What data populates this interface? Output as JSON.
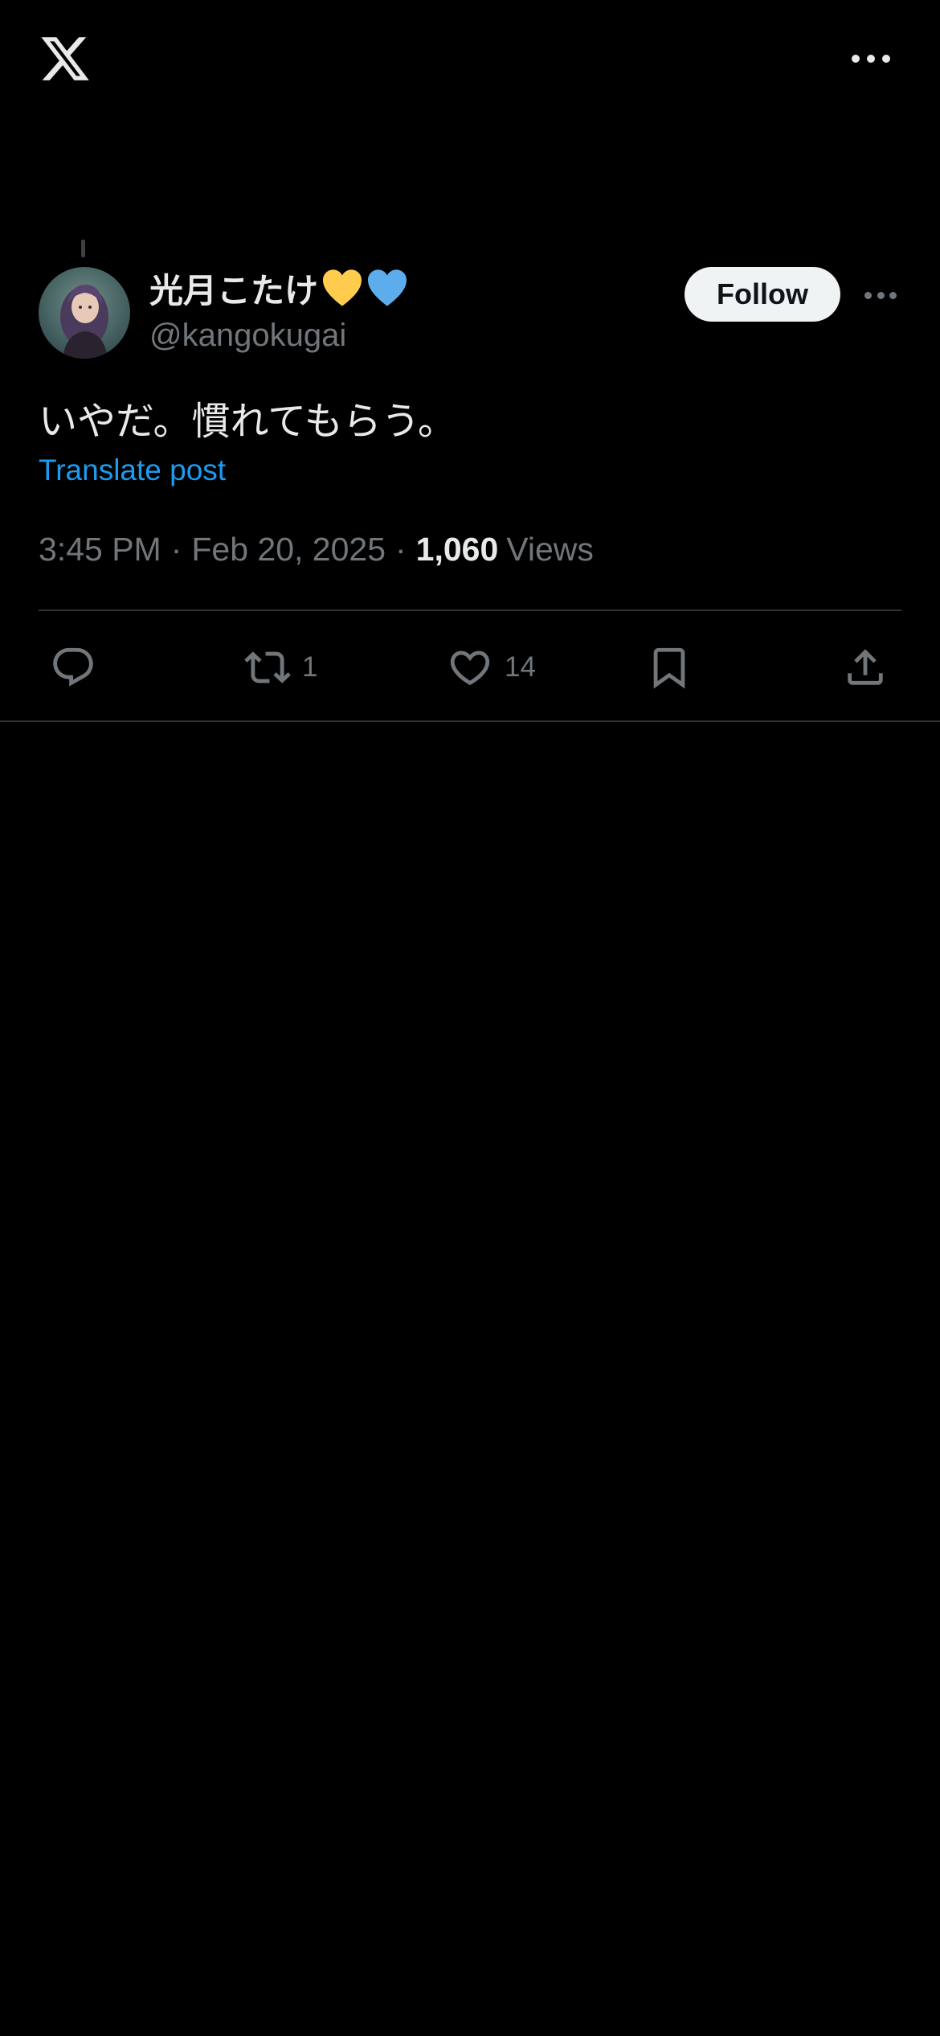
{
  "header": {
    "logo_icon": "x-logo-icon",
    "more_icon": "more-horizontal-icon"
  },
  "post": {
    "author": {
      "display_name": "光月こたけ",
      "name_emojis": [
        "yellow-heart",
        "blue-heart"
      ],
      "handle": "@kangokugai",
      "avatar_icon": "avatar"
    },
    "follow_label": "Follow",
    "text": "いやだ。慣れてもらう。",
    "translate_label": "Translate post",
    "time": "3:45 PM",
    "date": "Feb 20, 2025",
    "separator": "·",
    "views_count": "1,060",
    "views_label": "Views",
    "actions": {
      "reply": {
        "icon": "reply-icon",
        "count": ""
      },
      "retweet": {
        "icon": "retweet-icon",
        "count": "1"
      },
      "like": {
        "icon": "heart-icon",
        "count": "14"
      },
      "bookmark": {
        "icon": "bookmark-icon",
        "count": ""
      },
      "share": {
        "icon": "share-icon",
        "count": ""
      }
    }
  },
  "colors": {
    "background": "#000000",
    "text_primary": "#e7e9ea",
    "text_secondary": "#71767b",
    "link": "#1d9bf0",
    "divider": "#2f3336",
    "follow_bg": "#eff3f4",
    "heart_yellow": "#ffcc4d",
    "heart_blue": "#5dadec"
  }
}
